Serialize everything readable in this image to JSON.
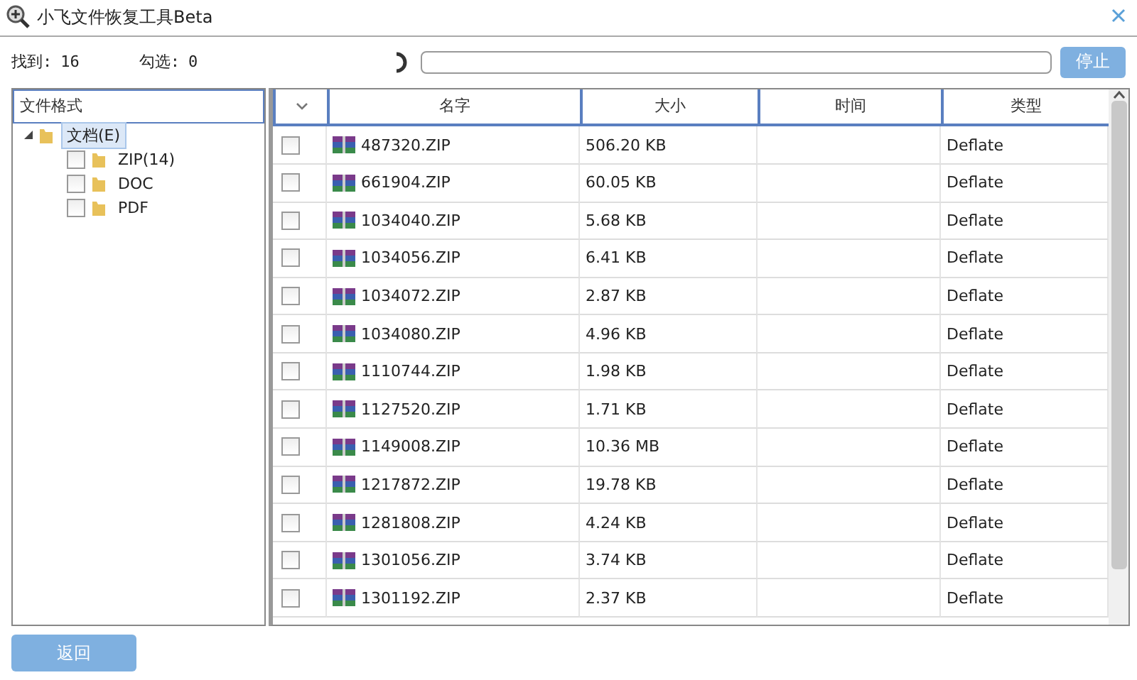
{
  "window": {
    "title": "小飞文件恢复工具Beta"
  },
  "stats": {
    "found_label": "找到:",
    "found": "16",
    "checked_label": "勾选:",
    "checked": "0"
  },
  "progress": {
    "level": 0
  },
  "stop_button": "停止",
  "tree": {
    "header": "文件格式",
    "items": [
      {
        "label": "文档(E)",
        "expanded": true,
        "selected": true,
        "children": [
          {
            "label": "ZIP(14)",
            "checked": false
          },
          {
            "label": "DOC",
            "checked": false
          },
          {
            "label": "PDF",
            "checked": false
          }
        ]
      }
    ]
  },
  "table": {
    "columns": [
      "名字",
      "大小",
      "时间",
      "类型"
    ],
    "rows": [
      {
        "name": "487320.ZIP",
        "size": "506.20 KB",
        "time": "",
        "type": "Deflate",
        "checked": false
      },
      {
        "name": "661904.ZIP",
        "size": "60.05 KB",
        "time": "",
        "type": "Deflate",
        "checked": false
      },
      {
        "name": "1034040.ZIP",
        "size": "5.68 KB",
        "time": "",
        "type": "Deflate",
        "checked": false
      },
      {
        "name": "1034056.ZIP",
        "size": "6.41 KB",
        "time": "",
        "type": "Deflate",
        "checked": false
      },
      {
        "name": "1034072.ZIP",
        "size": "2.87 KB",
        "time": "",
        "type": "Deflate",
        "checked": false
      },
      {
        "name": "1034080.ZIP",
        "size": "4.96 KB",
        "time": "",
        "type": "Deflate",
        "checked": false
      },
      {
        "name": "1110744.ZIP",
        "size": "1.98 KB",
        "time": "",
        "type": "Deflate",
        "checked": false
      },
      {
        "name": "1127520.ZIP",
        "size": "1.71 KB",
        "time": "",
        "type": "Deflate",
        "checked": false
      },
      {
        "name": "1149008.ZIP",
        "size": "10.36 MB",
        "time": "",
        "type": "Deflate",
        "checked": false
      },
      {
        "name": "1217872.ZIP",
        "size": "19.78 KB",
        "time": "",
        "type": "Deflate",
        "checked": false
      },
      {
        "name": "1281808.ZIP",
        "size": "4.24 KB",
        "time": "",
        "type": "Deflate",
        "checked": false
      },
      {
        "name": "1301056.ZIP",
        "size": "3.74 KB",
        "time": "",
        "type": "Deflate",
        "checked": false
      },
      {
        "name": "1301192.ZIP",
        "size": "2.37 KB",
        "time": "",
        "type": "Deflate",
        "checked": false
      }
    ]
  },
  "back_button": "返回"
}
